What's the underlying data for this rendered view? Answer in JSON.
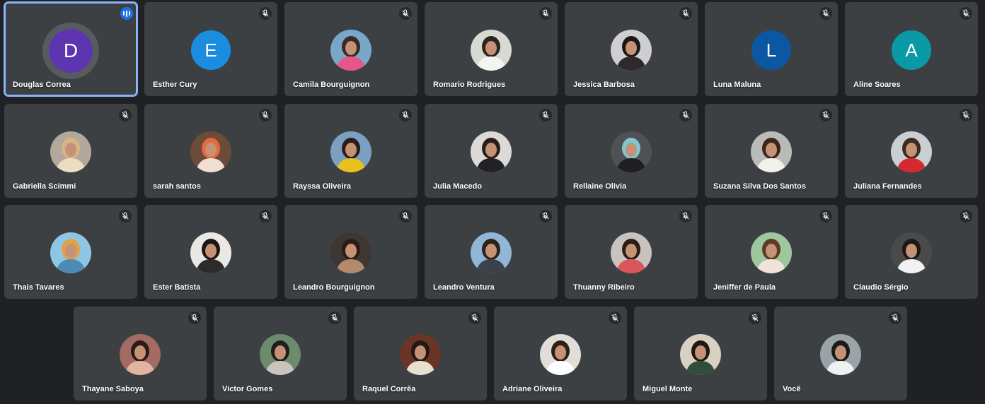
{
  "meeting": {
    "rows": [
      [
        {
          "name": "Douglas Correa",
          "initial": "D",
          "color": "#5e35b1",
          "speaking": true,
          "muted": false
        },
        {
          "name": "Esther Cury",
          "initial": "E",
          "color": "#1a8de0",
          "muted": true
        },
        {
          "name": "Camila Bourguignon",
          "photo": [
            "#79a7c9",
            "#3a2a24",
            "#e7568a"
          ],
          "muted": true
        },
        {
          "name": "Romario Rodrigues",
          "photo": [
            "#d9d9d4",
            "#2a2520",
            "#f4f4f2"
          ],
          "muted": true
        },
        {
          "name": "Jessica Barbosa",
          "photo": [
            "#cfcfd2",
            "#1a1718",
            "#2e2a2b"
          ],
          "muted": true
        },
        {
          "name": "Luna Maluna",
          "initial": "L",
          "color": "#0b57a4",
          "muted": true
        },
        {
          "name": "Aline Soares",
          "initial": "A",
          "color": "#0a9aa6",
          "muted": true
        }
      ],
      [
        {
          "name": "Gabriella Scimmi",
          "photo": [
            "#b2a89b",
            "#d7b488",
            "#e9dec2"
          ],
          "muted": true
        },
        {
          "name": "sarah santos",
          "photo": [
            "#6c4b39",
            "#e36a3d",
            "#f2dfd4"
          ],
          "muted": true
        },
        {
          "name": "Rayssa Oliveira",
          "photo": [
            "#7aa0c2",
            "#2b1d16",
            "#e8c21b"
          ],
          "muted": true
        },
        {
          "name": "Julia Macedo",
          "photo": [
            "#dcdad6",
            "#2a1e19",
            "#222224"
          ],
          "muted": true
        },
        {
          "name": "Rellaine Olivia",
          "photo": [
            "#4e5255",
            "#7dc9cf",
            "#1f1f23"
          ],
          "muted": true
        },
        {
          "name": "Suzana Silva Dos Santos",
          "photo": [
            "#b9bbb9",
            "#3c2619",
            "#f3f1ec"
          ],
          "muted": true
        },
        {
          "name": "Juliana Fernandes",
          "photo": [
            "#c9cfd3",
            "#3b2b23",
            "#d8282f"
          ],
          "muted": true
        }
      ],
      [
        {
          "name": "Thais Tavares",
          "photo": [
            "#8ec7e6",
            "#e0a246",
            "#4f8ab7"
          ],
          "muted": true
        },
        {
          "name": "Ester Batista",
          "photo": [
            "#e9e8e5",
            "#191615",
            "#2d2a2a"
          ],
          "muted": true
        },
        {
          "name": "Leandro Bourguignon",
          "photo": [
            "#3e3633",
            "#2a1d16",
            "#b48a6d"
          ],
          "muted": true
        },
        {
          "name": "Leandro Ventura",
          "photo": [
            "#91b6d6",
            "#2c211b",
            "#39424d"
          ],
          "muted": true
        },
        {
          "name": "Thuanny Ribeiro",
          "photo": [
            "#c9c2bd",
            "#2a1d17",
            "#d9565a"
          ],
          "muted": true
        },
        {
          "name": "Jeniffer de Paula",
          "photo": [
            "#9fc79d",
            "#5d3a27",
            "#f1e3da"
          ],
          "muted": true
        },
        {
          "name": "Claudio Sérgio",
          "photo": [
            "#4a4a4a",
            "#1d1715",
            "#f2f2f2"
          ],
          "muted": true
        }
      ],
      [
        {
          "name": "Thayane Saboya",
          "photo": [
            "#a36b61",
            "#2b1b17",
            "#e2b4a2"
          ],
          "muted": true
        },
        {
          "name": "Victor Gomes",
          "photo": [
            "#6c8a6e",
            "#1e1e1e",
            "#c9c4bc"
          ],
          "muted": true
        },
        {
          "name": "Raquel Corrêa",
          "photo": [
            "#6a3526",
            "#221816",
            "#e8e0cf"
          ],
          "muted": true
        },
        {
          "name": "Adriane Oliveira",
          "photo": [
            "#e1ddd9",
            "#2b201a",
            "#ffffff"
          ],
          "muted": true
        },
        {
          "name": "Miguel Monte",
          "photo": [
            "#d8d1c3",
            "#1f1812",
            "#2e4f3c"
          ],
          "muted": true
        },
        {
          "name": "Você",
          "photo": [
            "#9aa3a7",
            "#1a1a1a",
            "#f0f0f0"
          ],
          "muted": true
        }
      ]
    ]
  }
}
